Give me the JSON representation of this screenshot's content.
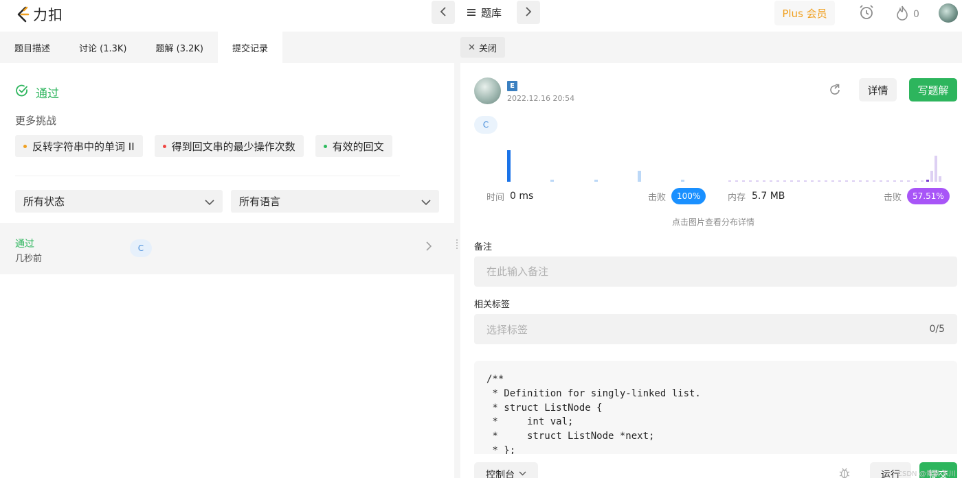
{
  "topbar": {
    "logo_text": "力扣",
    "problemset_label": "题库",
    "plus_label": "Plus 会员",
    "streak_count": "0"
  },
  "left": {
    "tabs": [
      {
        "label": "题目描述"
      },
      {
        "label": "讨论 (1.3K)"
      },
      {
        "label": "题解 (3.2K)"
      },
      {
        "label": "提交记录"
      }
    ],
    "result_label": "通过",
    "more_challenges_title": "更多挑战",
    "challenges": [
      {
        "label": "反转字符串中的单词 II",
        "color": "#f0a020"
      },
      {
        "label": "得到回文串的最少操作次数",
        "color": "#ef4743"
      },
      {
        "label": "有效的回文",
        "color": "#2cbb5d"
      }
    ],
    "status_filter": "所有状态",
    "language_filter": "所有语言",
    "submission": {
      "status": "通过",
      "time": "几秒前",
      "language": "C"
    }
  },
  "right": {
    "close_tab_label": "关闭",
    "badge": "E",
    "date": "2022.12.16 20:54",
    "detail_label": "详情",
    "write_solution_label": "写题解",
    "language": "C",
    "stats": {
      "time_label": "时间",
      "time_value": "0 ms",
      "time_beat_label": "击败",
      "time_beat_value": "100%",
      "memory_label": "内存",
      "memory_value": "5.7 MB",
      "memory_beat_label": "击败",
      "memory_beat_value": "57.51%"
    },
    "chart_hint": "点击图片查看分布详情",
    "note_label": "备注",
    "note_placeholder": "在此输入备注",
    "tags_label": "相关标签",
    "tags_placeholder": "选择标签",
    "tags_count": "0/5",
    "code_lines": [
      "/**",
      " * Definition for singly-linked list.",
      " * struct ListNode {",
      " *     int val;",
      " *     struct ListNode *next;",
      " * };"
    ],
    "console_label": "控制台",
    "run_label": "运行",
    "submit_label": "提交",
    "watermark": "CSDN @青枫·东川"
  },
  "colors": {
    "accent_green": "#2db55d",
    "time_beat_blue": "#1a90ff",
    "memory_beat_purple": "#a855f7",
    "plus_orange": "#f0a020"
  }
}
